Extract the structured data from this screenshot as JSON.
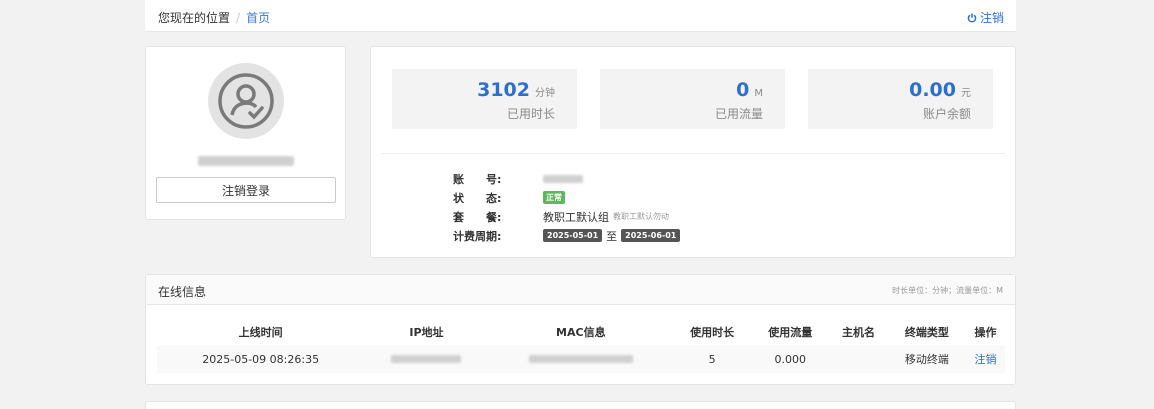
{
  "breadcrumb": {
    "here": "您现在的位置",
    "sep": "/",
    "home": "首页"
  },
  "top_logout": "注销",
  "profile": {
    "logout_button": "注销登录"
  },
  "stats": [
    {
      "value": "3102",
      "unit": "分钟",
      "label": "已用时长"
    },
    {
      "value": "0",
      "unit": "M",
      "label": "已用流量"
    },
    {
      "value": "0.00",
      "unit": "元",
      "label": "账户余额"
    }
  ],
  "account_info": {
    "account_label": "账　　号:",
    "status_label": "状　　态:",
    "status_badge": "正常",
    "plan_label": "套　　餐:",
    "plan_value": "教职工默认组",
    "plan_sub": "教职工默认勿动",
    "period_label": "计费周期:",
    "period_start": "2025-05-01",
    "period_to": "至",
    "period_end": "2025-06-01"
  },
  "online": {
    "title": "在线信息",
    "unit_note": "时长单位：分钟；流量单位：M",
    "columns": [
      "上线时间",
      "IP地址",
      "MAC信息",
      "使用时长",
      "使用流量",
      "主机名",
      "终端类型",
      "操作"
    ],
    "rows": [
      {
        "time": "2025-05-09 08:26:35",
        "duration": "5",
        "traffic": "0.000",
        "host": "",
        "terminal": "移动终端",
        "action": "注销"
      }
    ]
  },
  "colors": {
    "accent": "#2d6fcf",
    "status_ok": "#5cb85c",
    "background": "#f2f2f2"
  }
}
